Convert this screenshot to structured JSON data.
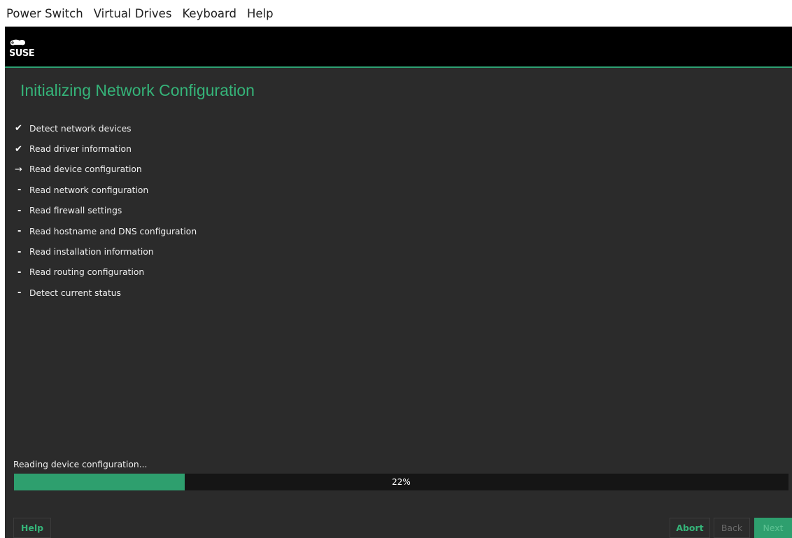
{
  "viewer_menu": {
    "items": [
      "Power Switch",
      "Virtual Drives",
      "Keyboard",
      "Help"
    ]
  },
  "branding": {
    "logo_text": "SUSE",
    "accent_color": "#35b479",
    "brand_bar_color": "#000000"
  },
  "page": {
    "title": "Initializing Network Configuration"
  },
  "steps": [
    {
      "state": "done",
      "marker": "✔",
      "label": "Detect network devices"
    },
    {
      "state": "done",
      "marker": "✔",
      "label": "Read driver information"
    },
    {
      "state": "current",
      "marker": "→",
      "label": "Read device configuration"
    },
    {
      "state": "pending",
      "marker": "-",
      "label": "Read network configuration"
    },
    {
      "state": "pending",
      "marker": "-",
      "label": "Read firewall settings"
    },
    {
      "state": "pending",
      "marker": "-",
      "label": "Read hostname and DNS configuration"
    },
    {
      "state": "pending",
      "marker": "-",
      "label": "Read installation information"
    },
    {
      "state": "pending",
      "marker": "-",
      "label": "Read routing configuration"
    },
    {
      "state": "pending",
      "marker": "-",
      "label": "Detect current status"
    }
  ],
  "status": {
    "message": "Reading device configuration...",
    "progress_percent": 22,
    "progress_label": "22%"
  },
  "buttons": {
    "help": "Help",
    "abort": "Abort",
    "back": "Back",
    "next": "Next"
  }
}
